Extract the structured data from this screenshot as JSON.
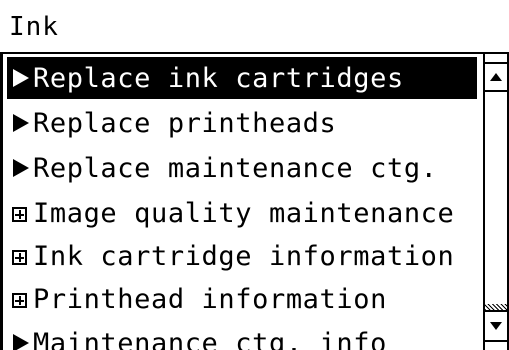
{
  "window": {
    "title": "Ink"
  },
  "menu": {
    "items": [
      {
        "label": "Replace ink cartridges",
        "icon": "arrow-right-icon",
        "selected": true
      },
      {
        "label": "Replace printheads",
        "icon": "arrow-right-icon",
        "selected": false
      },
      {
        "label": "Replace maintenance ctg.",
        "icon": "arrow-right-icon",
        "selected": false
      },
      {
        "label": "Image quality maintenance",
        "icon": "expand-plus-icon",
        "selected": false
      },
      {
        "label": "Ink cartridge information",
        "icon": "expand-plus-icon",
        "selected": false
      },
      {
        "label": "Printhead information",
        "icon": "expand-plus-icon",
        "selected": false
      },
      {
        "label": "Maintenance ctg. info",
        "icon": "arrow-right-icon",
        "selected": false
      }
    ]
  },
  "scrollbar": {
    "up_icon": "scroll-up-arrow-icon",
    "down_icon": "scroll-down-arrow-icon",
    "position": 0.95
  },
  "colors": {
    "selection_bg": "#000000",
    "selection_fg": "#ffffff",
    "text": "#000000",
    "background": "#ffffff"
  }
}
